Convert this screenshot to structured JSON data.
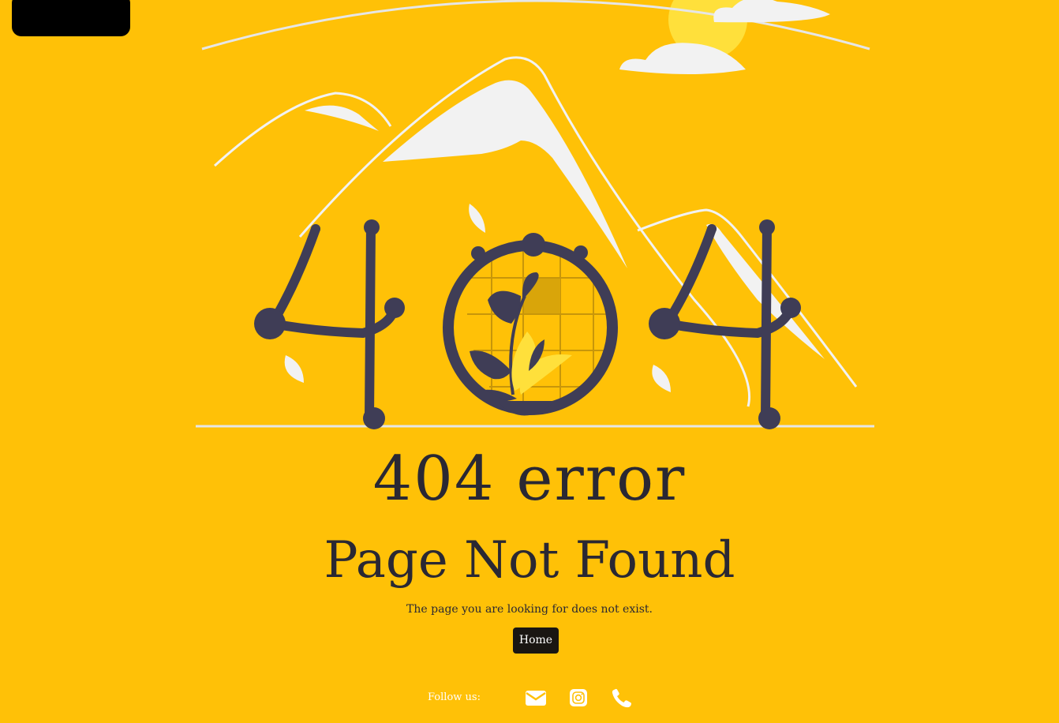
{
  "error": {
    "code_text": "404 error",
    "title": "Page Not Found",
    "message": "The page you are looking for does not exist."
  },
  "actions": {
    "home_label": "Home"
  },
  "footer": {
    "follow_label": "Follow us:",
    "social": [
      {
        "icon": "envelope-icon"
      },
      {
        "icon": "instagram-icon"
      },
      {
        "icon": "phone-icon"
      }
    ]
  },
  "colors": {
    "background": "#FFC107",
    "text": "#2A2833",
    "button": "#1A1612",
    "illustration_dark": "#3F3D56",
    "illustration_light": "#F2F2F2"
  }
}
